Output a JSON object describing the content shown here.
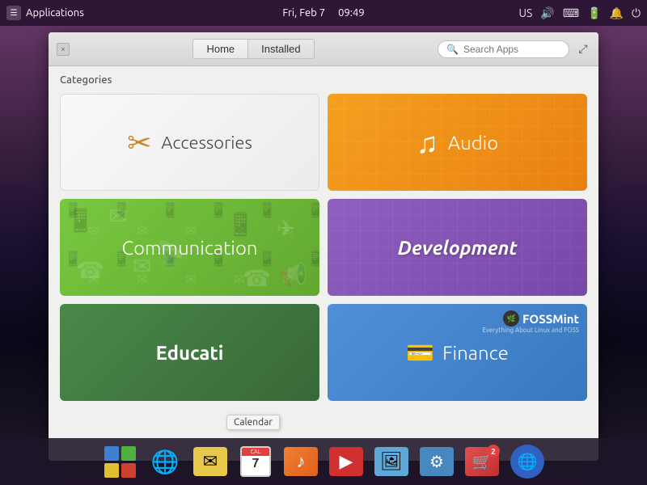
{
  "topPanel": {
    "appName": "Applications",
    "date": "Fri, Feb 7",
    "time": "09:49",
    "locale": "US"
  },
  "window": {
    "closeBtn": "×",
    "navButtons": [
      {
        "label": "Home",
        "active": false
      },
      {
        "label": "Installed",
        "active": true
      }
    ],
    "searchPlaceholder": "Search Apps",
    "maximizeIcon": "⤢"
  },
  "categories": {
    "label": "Categories",
    "items": [
      {
        "id": "accessories",
        "name": "Accessories",
        "style": "accessories"
      },
      {
        "id": "audio",
        "name": "Audio",
        "style": "audio"
      },
      {
        "id": "communication",
        "name": "Communication",
        "style": "communication"
      },
      {
        "id": "development",
        "name": "Development",
        "style": "development"
      },
      {
        "id": "education",
        "name": "Educati",
        "style": "education"
      },
      {
        "id": "finance",
        "name": "Finance",
        "style": "finance"
      }
    ]
  },
  "tooltip": {
    "text": "Calendar"
  },
  "taskbar": {
    "items": [
      {
        "id": "grid-launcher",
        "type": "grid"
      },
      {
        "id": "browser",
        "type": "globe"
      },
      {
        "id": "mail",
        "type": "mail"
      },
      {
        "id": "calendar",
        "type": "calendar"
      },
      {
        "id": "music",
        "type": "music"
      },
      {
        "id": "video",
        "type": "video"
      },
      {
        "id": "photos",
        "type": "photos"
      },
      {
        "id": "settings",
        "type": "settings"
      },
      {
        "id": "appstore",
        "type": "appstore",
        "badge": "2"
      },
      {
        "id": "network",
        "type": "network"
      }
    ]
  }
}
